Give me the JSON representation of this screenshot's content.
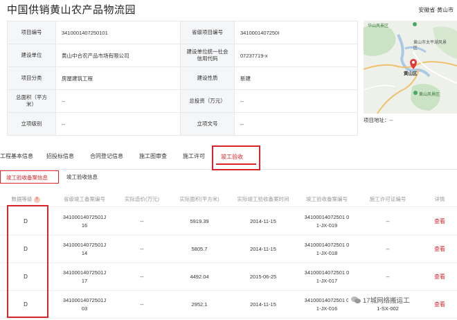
{
  "header": {
    "title": "中国供销黄山农产品物流园",
    "region": "安徽省·黄山市"
  },
  "info": {
    "project_no_label": "项目编号",
    "project_no": "3410001407250101",
    "prov_no_label": "省级项目编号",
    "prov_no": "3410001407250I",
    "builder_label": "建设单位",
    "builder": "黄山中合农产品市场有限公司",
    "credit_label": "建设单位统一社会信用代码",
    "credit": "07237719-x",
    "category_label": "项目分类",
    "category": "房屋建筑工程",
    "nature_label": "建设性质",
    "nature": "新建",
    "area_label": "总面积（平方米）",
    "area": "--",
    "invest_label": "总投资（万元）",
    "invest": "--",
    "level_label": "立项级别",
    "level": "--",
    "docno_label": "立项文号",
    "docno": "--"
  },
  "map": {
    "labels": [
      "华山风景区",
      "黄山市太平湖风景区",
      "黄山区",
      "黄山风景区"
    ],
    "address_label": "项目地址：",
    "address": "--"
  },
  "tabs": [
    {
      "label": "工程基本信息"
    },
    {
      "label": "招投标信息"
    },
    {
      "label": "合同登记信息"
    },
    {
      "label": "施工图审查"
    },
    {
      "label": "施工许可"
    },
    {
      "label": "竣工验收",
      "active": true
    }
  ],
  "subtabs": {
    "active": "竣工验收备案信息",
    "other": "竣工验收信息"
  },
  "table": {
    "headers": [
      "数据等级",
      "省级竣工备案编号",
      "实际造价(万元)",
      "实际面积(平方米)",
      "实际竣工验收备案时间",
      "竣工验收备案编号",
      "施工许可证编号",
      "详情"
    ],
    "rows": [
      {
        "grade": "D",
        "prov_no_1": "34100014072501J",
        "prov_no_2": "16",
        "cost": "--",
        "area": "5919.39",
        "date": "2014-11-15",
        "rec_1": "34100014072501 0",
        "rec_2": "1-JX-019",
        "permit": "--",
        "detail": "查看"
      },
      {
        "grade": "D",
        "prov_no_1": "34100014072501J",
        "prov_no_2": "14",
        "cost": "--",
        "area": "5805.7",
        "date": "2014-11-15",
        "rec_1": "34100014072501 0",
        "rec_2": "1-JX-018",
        "permit": "--",
        "detail": "查看"
      },
      {
        "grade": "D",
        "prov_no_1": "34100014072501J",
        "prov_no_2": "17",
        "cost": "--",
        "area": "4492.04",
        "date": "2015-06-25",
        "rec_1": "34100014072501 0",
        "rec_2": "1-JX-017",
        "permit": "--",
        "detail": "查看"
      },
      {
        "grade": "D",
        "prov_no_1": "34100014072501J",
        "prov_no_2": "03",
        "cost": "--",
        "area": "2952.1",
        "date": "2014-11-15",
        "rec_1": "34100014072501 0",
        "rec_2": "1-JX-016",
        "permit": "1-SX-002",
        "detail": "查看"
      }
    ]
  },
  "watermark": {
    "text": "17城网络搬运工"
  },
  "colors": {
    "accent": "#d9252a",
    "label_bg": "#f5f6f8",
    "border": "#e8e8e8"
  }
}
